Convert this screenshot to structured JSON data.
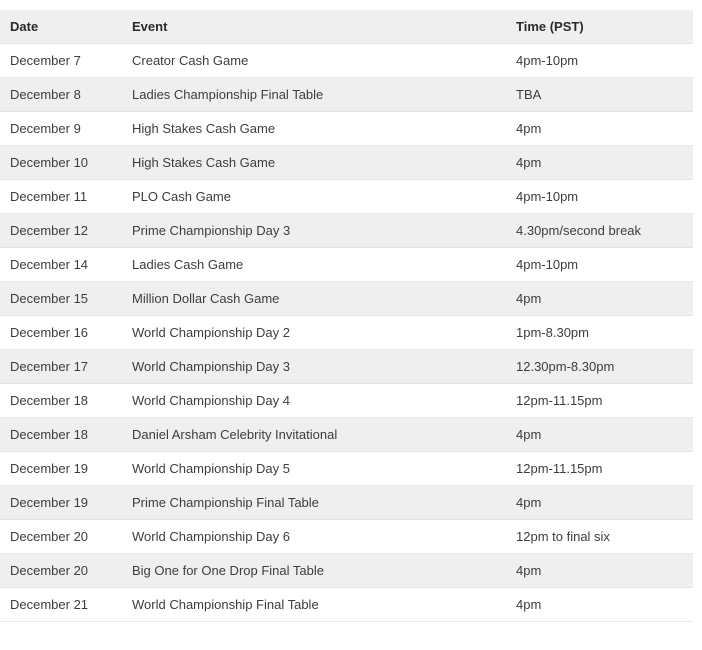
{
  "table": {
    "columns": [
      "Date",
      "Event",
      "Time (PST)"
    ],
    "rows": [
      {
        "date": "December 7",
        "event": "Creator Cash Game",
        "time": "4pm-10pm"
      },
      {
        "date": "December 8",
        "event": "Ladies Championship Final Table",
        "time": "TBA"
      },
      {
        "date": "December 9",
        "event": "High Stakes Cash Game",
        "time": "4pm"
      },
      {
        "date": "December 10",
        "event": "High Stakes Cash Game",
        "time": "4pm"
      },
      {
        "date": "December 11",
        "event": "PLO Cash Game",
        "time": "4pm-10pm"
      },
      {
        "date": "December 12",
        "event": "Prime Championship Day 3",
        "time": "4.30pm/second break"
      },
      {
        "date": "December 14",
        "event": "Ladies Cash Game",
        "time": "4pm-10pm"
      },
      {
        "date": "December 15",
        "event": "Million Dollar Cash Game",
        "time": "4pm"
      },
      {
        "date": "December 16",
        "event": "World Championship Day 2",
        "time": "1pm-8.30pm"
      },
      {
        "date": "December 17",
        "event": "World Championship Day 3",
        "time": "12.30pm-8.30pm"
      },
      {
        "date": "December 18",
        "event": "World Championship Day 4",
        "time": "12pm-11.15pm"
      },
      {
        "date": "December 18",
        "event": "Daniel Arsham Celebrity Invitational",
        "time": "4pm"
      },
      {
        "date": "December 19",
        "event": "World Championship Day 5",
        "time": "12pm-11.15pm"
      },
      {
        "date": "December 19",
        "event": "Prime Championship Final Table",
        "time": "4pm"
      },
      {
        "date": "December 20",
        "event": "World Championship Day 6",
        "time": "12pm to final six"
      },
      {
        "date": "December 20",
        "event": "Big One for One Drop Final Table",
        "time": "4pm"
      },
      {
        "date": "December 21",
        "event": "World Championship Final Table",
        "time": "4pm"
      }
    ]
  },
  "colors": {
    "header_background": "#efefef",
    "stripe_background": "#efefef",
    "page_background": "#ffffff",
    "text": "#3d3d3d",
    "header_text": "#2b2b2b",
    "row_border": "#e8e8e8"
  }
}
